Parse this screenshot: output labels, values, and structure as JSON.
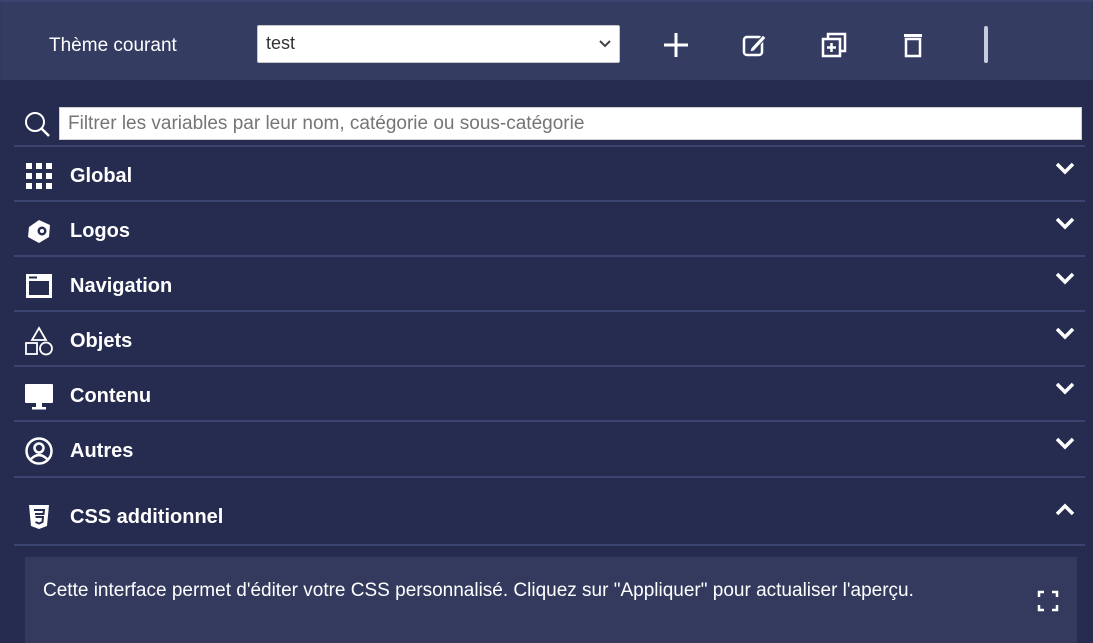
{
  "header": {
    "theme_label": "Thème courant",
    "theme_selected": "test",
    "tools": [
      "add-icon",
      "edit-icon",
      "duplicate-icon",
      "delete-icon"
    ]
  },
  "search": {
    "placeholder": "Filtrer les variables par leur nom, catégorie ou sous-catégorie"
  },
  "sections": [
    {
      "label": "Global",
      "icon": "grid-icon",
      "state": "collapsed"
    },
    {
      "label": "Logos",
      "icon": "logo-icon",
      "state": "collapsed"
    },
    {
      "label": "Navigation",
      "icon": "browser-window-icon",
      "state": "collapsed"
    },
    {
      "label": "Objets",
      "icon": "shapes-icon",
      "state": "collapsed"
    },
    {
      "label": "Contenu",
      "icon": "monitor-icon",
      "state": "collapsed"
    },
    {
      "label": "Autres",
      "icon": "user-circle-icon",
      "state": "collapsed"
    },
    {
      "label": "CSS additionnel",
      "icon": "css3-icon",
      "state": "expanded"
    }
  ],
  "css_panel": {
    "description": "Cette interface permet d'éditer votre CSS personnalisé. Cliquez sur \"Appliquer\" pour actualiser l'aperçu.",
    "expand_icon": "fullscreen-icon"
  },
  "colors": {
    "background": "#262c4f",
    "topbar": "#343c62",
    "divider": "#3b4470",
    "text": "#ffffff"
  }
}
